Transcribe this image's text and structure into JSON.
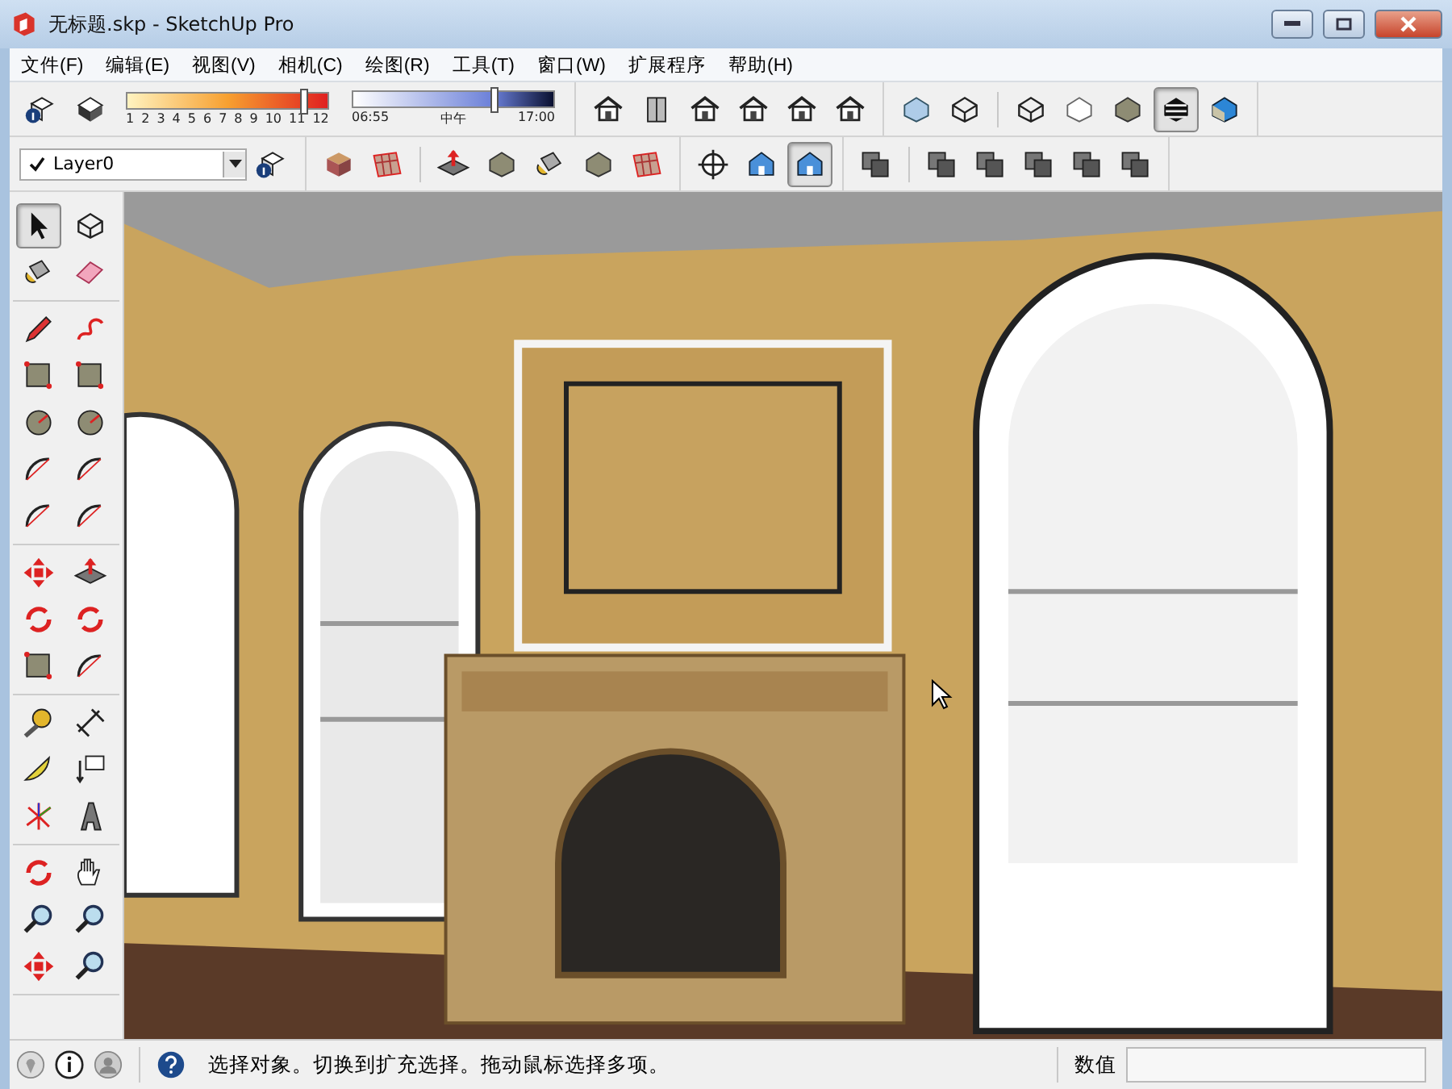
{
  "window": {
    "title": "无标题.skp - SketchUp Pro"
  },
  "menu": [
    "文件(F)",
    "编辑(E)",
    "视图(V)",
    "相机(C)",
    "绘图(R)",
    "工具(T)",
    "窗口(W)",
    "扩展程序",
    "帮助(H)"
  ],
  "toolbar_row_1": {
    "left_tools": [
      {
        "kind": "info-cube",
        "selected": false
      },
      {
        "kind": "dark-cube",
        "selected": false
      }
    ],
    "shadow_month": {
      "labels": [
        "1",
        "2",
        "3",
        "4",
        "5",
        "6",
        "7",
        "8",
        "9",
        "10",
        "11",
        "12"
      ],
      "level": 0.88
    },
    "shadow_time": {
      "start": "06:55",
      "middle": "中午",
      "end": "17:00",
      "level": 0.7
    },
    "view_tools": [
      {
        "kind": "house",
        "selected": false
      },
      {
        "kind": "book",
        "selected": false
      },
      {
        "kind": "house",
        "selected": false
      },
      {
        "kind": "house",
        "selected": false
      },
      {
        "kind": "house",
        "selected": false
      },
      {
        "kind": "house",
        "selected": false
      }
    ],
    "style_tools": [
      {
        "kind": "xray-cube",
        "selected": false
      },
      {
        "kind": "wire-cube",
        "selected": false
      },
      {
        "kind": "wire-cube",
        "selected": false
      },
      {
        "kind": "white-cube",
        "selected": false
      },
      {
        "kind": "grey-cube",
        "selected": false
      },
      {
        "kind": "striped-cube",
        "selected": true
      },
      {
        "kind": "blue-cube",
        "selected": false
      }
    ]
  },
  "toolbar_row_2": {
    "layer": {
      "value": "Layer0"
    },
    "layer_tools": [
      {
        "kind": "info-cube",
        "selected": false
      }
    ],
    "section_tools": [
      {
        "kind": "section",
        "selected": false
      },
      {
        "kind": "grid",
        "selected": false
      }
    ],
    "sandbox_tools": [
      {
        "kind": "pushpull",
        "selected": false
      },
      {
        "kind": "grey-cube",
        "selected": false
      },
      {
        "kind": "bucket",
        "selected": false
      },
      {
        "kind": "grey-cube",
        "selected": false
      },
      {
        "kind": "grid",
        "selected": false
      }
    ],
    "camera_tools": [
      {
        "kind": "crosshair",
        "selected": false
      },
      {
        "kind": "blue-house",
        "selected": false
      },
      {
        "kind": "blue-house",
        "selected": true
      }
    ],
    "solid_tools": [
      {
        "kind": "box-pair",
        "selected": false
      },
      {
        "kind": "box-pair",
        "selected": false
      },
      {
        "kind": "box-pair",
        "selected": false
      },
      {
        "kind": "box-pair",
        "selected": false
      },
      {
        "kind": "box-pair",
        "selected": false
      },
      {
        "kind": "box-pair",
        "selected": false
      }
    ]
  },
  "tool_palette": [
    [
      {
        "kind": "cursor",
        "selected": true
      },
      {
        "kind": "wire-cube",
        "selected": false
      },
      {
        "kind": "bucket",
        "selected": false
      },
      {
        "kind": "eraser",
        "selected": false
      }
    ],
    [
      {
        "kind": "pencil",
        "selected": false
      },
      {
        "kind": "curve",
        "selected": false
      },
      {
        "kind": "square",
        "selected": false
      },
      {
        "kind": "square",
        "selected": false
      },
      {
        "kind": "circle",
        "selected": false
      },
      {
        "kind": "circle",
        "selected": false
      },
      {
        "kind": "arc",
        "selected": false
      },
      {
        "kind": "arc",
        "selected": false
      },
      {
        "kind": "arc",
        "selected": false
      },
      {
        "kind": "arc",
        "selected": false
      }
    ],
    [
      {
        "kind": "arrows",
        "selected": false
      },
      {
        "kind": "pushpull",
        "selected": false
      },
      {
        "kind": "rotate",
        "selected": false
      },
      {
        "kind": "rotate",
        "selected": false
      },
      {
        "kind": "square",
        "selected": false
      },
      {
        "kind": "arc",
        "selected": false
      }
    ],
    [
      {
        "kind": "tape",
        "selected": false
      },
      {
        "kind": "dimension",
        "selected": false
      },
      {
        "kind": "protractor",
        "selected": false
      },
      {
        "kind": "text",
        "selected": false
      },
      {
        "kind": "axes",
        "selected": false
      },
      {
        "kind": "letter",
        "selected": false
      }
    ],
    [
      {
        "kind": "rotate",
        "selected": false
      },
      {
        "kind": "hand",
        "selected": false
      },
      {
        "kind": "magnifier",
        "selected": false
      },
      {
        "kind": "magnifier",
        "selected": false
      },
      {
        "kind": "arrows",
        "selected": false
      },
      {
        "kind": "magnifier",
        "selected": false
      }
    ]
  ],
  "status_bar": {
    "message": "选择对象。切换到扩充选择。拖动鼠标选择多项。",
    "measurement_label": "数值"
  }
}
